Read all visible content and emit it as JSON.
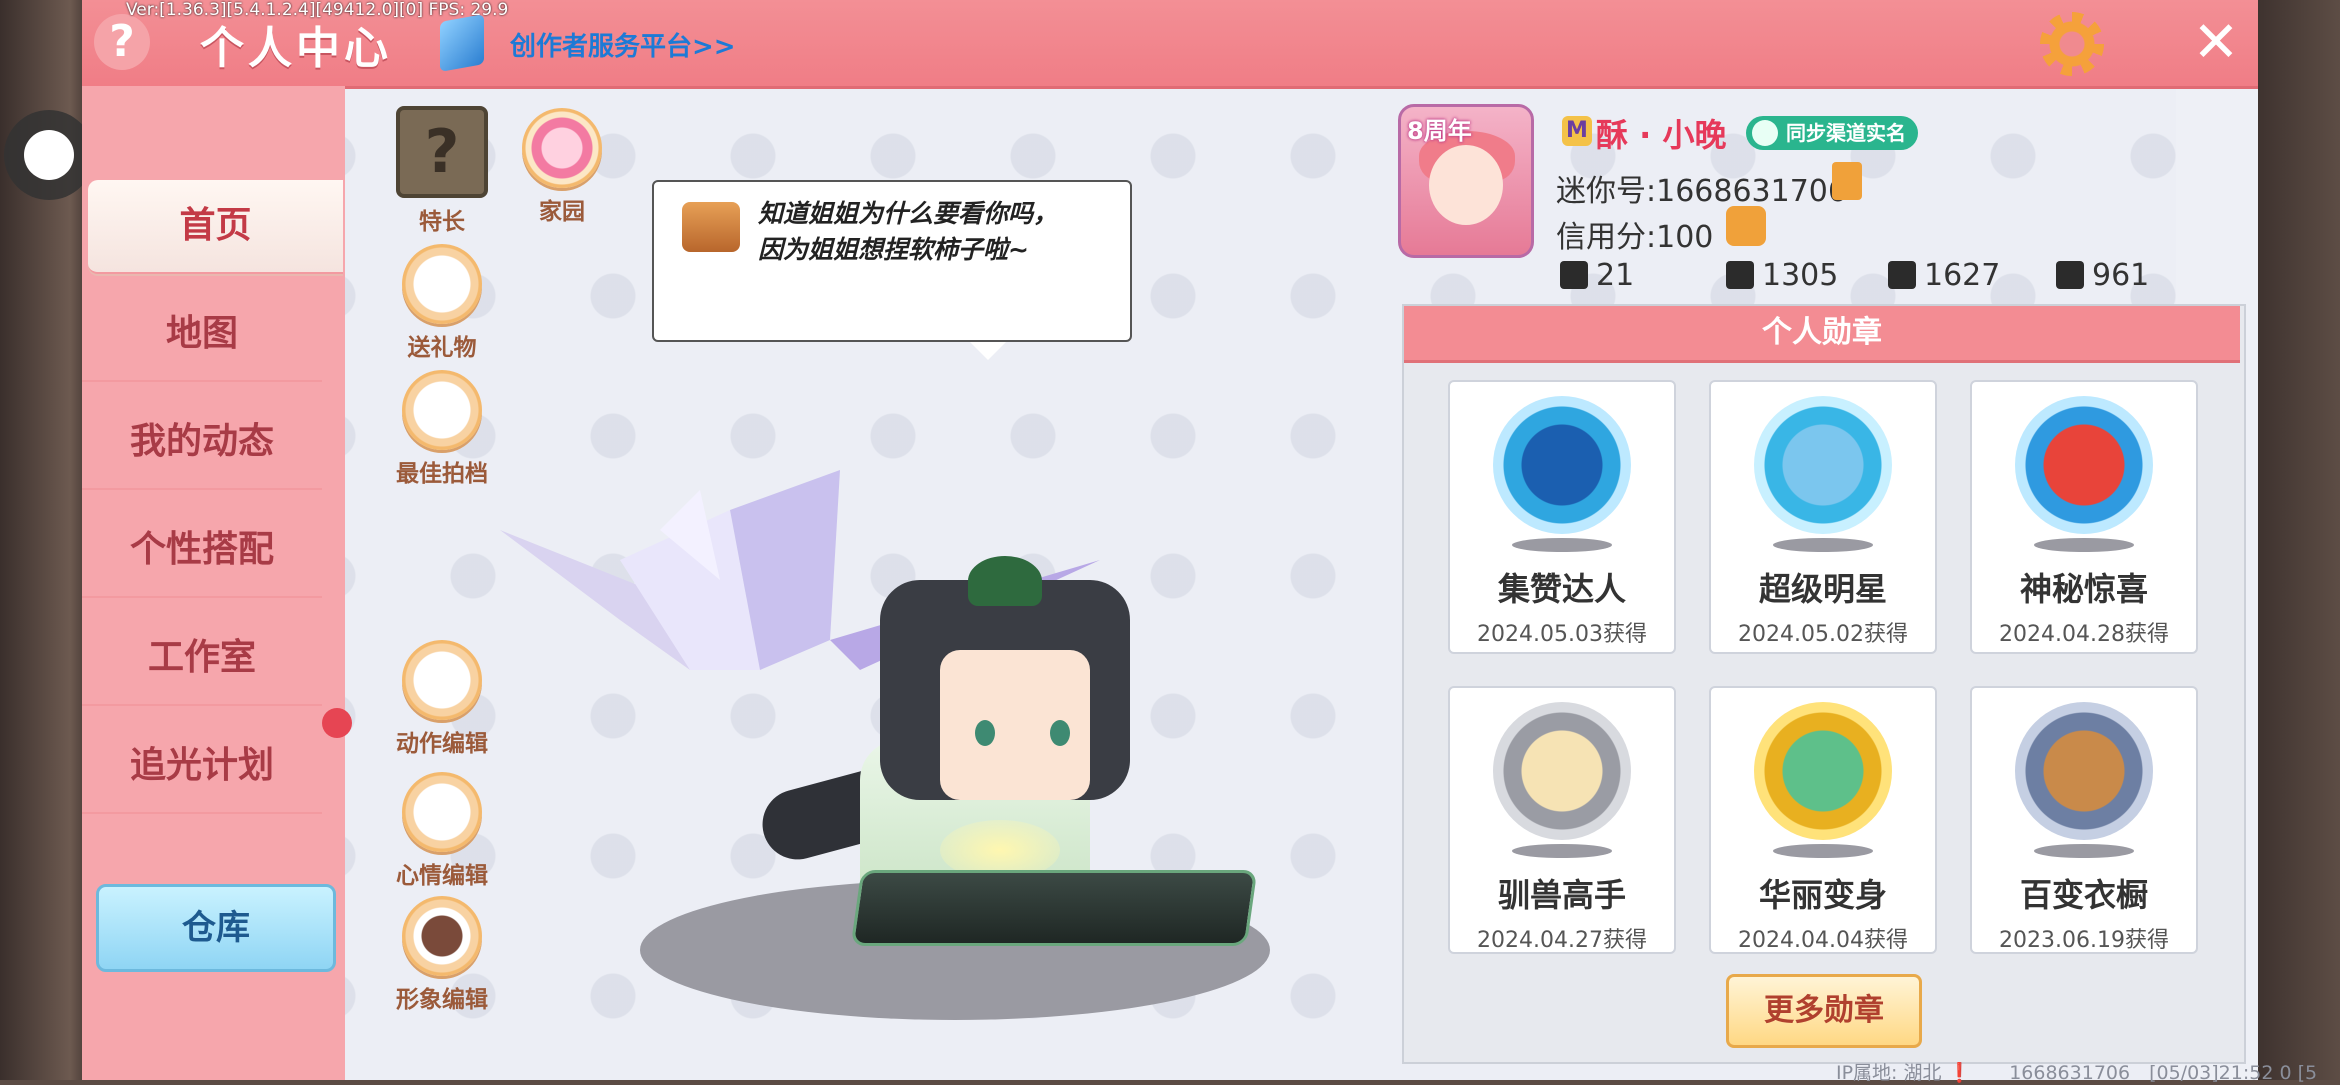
{
  "header": {
    "title": "个人中心",
    "debug": "Ver:[1.36.3][5.4.1.2.4][49412.0][0] FPS: 29.9",
    "creator_link": "创作者服务平台>>",
    "help_icon": "?",
    "close_icon": "✕"
  },
  "sidebar": {
    "items": [
      {
        "label": "首页",
        "active": true
      },
      {
        "label": "地图"
      },
      {
        "label": "我的动态"
      },
      {
        "label": "个性搭配"
      },
      {
        "label": "工作室"
      },
      {
        "label": "追光计划"
      }
    ],
    "warehouse": "仓库"
  },
  "actions": {
    "captain": "特长",
    "home": "家园",
    "gift": "送礼物",
    "best_partner": "最佳拍档",
    "action_edit": "动作编辑",
    "mood_edit": "心情编辑",
    "image_edit": "形象编辑"
  },
  "speech": "知道姐姐为什么要看你吗，　　　　因为姐姐想捏软柿子啦~",
  "profile": {
    "anniversary": "8周年",
    "vip": "M",
    "nickname": "酥 · 小晚",
    "realname_badge": "同步渠道实名",
    "mini_id": "迷你号:1668631706",
    "credit": "信用分:100",
    "stats": [
      {
        "icon": "plus-badge-icon",
        "value": "21"
      },
      {
        "icon": "fans-icon",
        "value": "1305"
      },
      {
        "icon": "flame-icon",
        "value": "1627"
      },
      {
        "icon": "heart-icon",
        "value": "961"
      }
    ]
  },
  "medals": {
    "title": "个人勋章",
    "items": [
      {
        "name": "集赞达人",
        "date": "2024.05.03获得",
        "color": "#2fa6e0"
      },
      {
        "name": "超级明星",
        "date": "2024.05.02获得",
        "color": "#39b6e6"
      },
      {
        "name": "神秘惊喜",
        "date": "2024.04.28获得",
        "color": "#2f9ae0"
      },
      {
        "name": "驯兽高手",
        "date": "2024.04.27获得",
        "color": "#9a9ca4"
      },
      {
        "name": "华丽变身",
        "date": "2024.04.04获得",
        "color": "#e8b020"
      },
      {
        "name": "百变衣橱",
        "date": "2023.06.19获得",
        "color": "#6d7fa3"
      }
    ],
    "more": "更多勋章"
  },
  "footer": "IP属地: 湖北 ❗　　1668631706　[05/03]21:52 0 [5"
}
